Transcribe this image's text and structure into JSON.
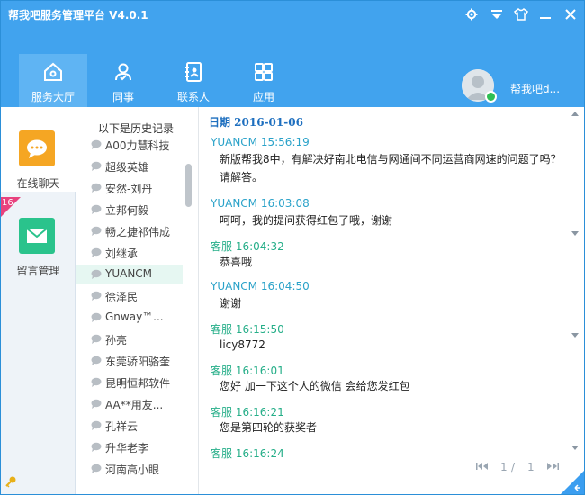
{
  "window": {
    "title": "帮我吧服务管理平台  V4.0.1",
    "controls": [
      "gear-icon",
      "dropdown-icon",
      "shirt-icon",
      "minimize-icon",
      "close-icon"
    ]
  },
  "nav": {
    "tabs": [
      {
        "label": "服务大厅",
        "icon": "home-icon",
        "active": true
      },
      {
        "label": "同事",
        "icon": "colleague-icon",
        "active": false
      },
      {
        "label": "联系人",
        "icon": "contact-book-icon",
        "active": false
      },
      {
        "label": "应用",
        "icon": "apps-grid-icon",
        "active": false
      }
    ],
    "user": {
      "name": "帮我吧d...",
      "status": "online"
    }
  },
  "sidebar": {
    "items": [
      {
        "label": "在线聊天",
        "icon": "chat-bubble-icon",
        "active": true
      },
      {
        "label": "留言管理",
        "icon": "mail-icon",
        "active": false
      }
    ],
    "badge": "16"
  },
  "contacts": {
    "header": "以下是历史记录",
    "items": [
      {
        "name": "A00力慧科技",
        "selected": false
      },
      {
        "name": "超级英雄",
        "selected": false
      },
      {
        "name": "安然-刘丹",
        "selected": false
      },
      {
        "name": "立邦何毅",
        "selected": false
      },
      {
        "name": "畅之捷祁伟成",
        "selected": false
      },
      {
        "name": "刘继承",
        "selected": false
      },
      {
        "name": "YUANCM",
        "selected": true
      },
      {
        "name": "徐泽民",
        "selected": false
      },
      {
        "name": "Gnway™...",
        "selected": false
      },
      {
        "name": "孙亮",
        "selected": false
      },
      {
        "name": "东莞骄阳骆奎",
        "selected": false
      },
      {
        "name": "昆明恒邦软件",
        "selected": false
      },
      {
        "name": "AA**用友...",
        "selected": false
      },
      {
        "name": "孔祥云",
        "selected": false
      },
      {
        "name": "升华老李",
        "selected": false
      },
      {
        "name": "河南高小眼",
        "selected": false
      }
    ]
  },
  "chat": {
    "date_label": "日期  2016-01-06",
    "messages": [
      {
        "sender": "YUANCM",
        "time": "15:56:19",
        "role": "user",
        "lines": [
          "新版帮我8中，有解决好南北电信与网通间不同运营商网速的问题了吗？",
          "请解答。"
        ]
      },
      {
        "sender": "YUANCM",
        "time": "16:03:08",
        "role": "user",
        "lines": [
          "呵呵，我的提问获得红包了哦，谢谢"
        ]
      },
      {
        "sender": "客服",
        "time": "16:04:32",
        "role": "agent",
        "lines": [
          "恭喜哦"
        ]
      },
      {
        "sender": "YUANCM",
        "time": "16:04:50",
        "role": "user",
        "lines": [
          "谢谢"
        ]
      },
      {
        "sender": "客服",
        "time": "16:15:50",
        "role": "agent",
        "lines": [
          "licy8772"
        ]
      },
      {
        "sender": "客服",
        "time": "16:16:01",
        "role": "agent",
        "lines": [
          "您好 加一下这个人的微信 会给您发红包"
        ]
      },
      {
        "sender": "客服",
        "time": "16:16:21",
        "role": "agent",
        "lines": [
          "您是第四轮的获奖者"
        ]
      },
      {
        "sender": "客服",
        "time": "16:16:24",
        "role": "agent",
        "lines": []
      }
    ],
    "pager": {
      "current": "1",
      "separator": "/",
      "total": "1"
    }
  }
}
